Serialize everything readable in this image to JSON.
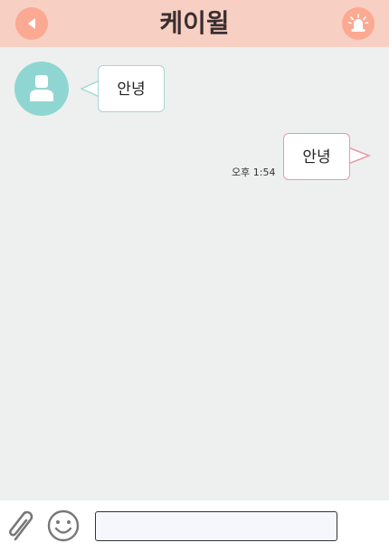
{
  "header": {
    "title": "케이윌",
    "back_icon": "back-arrow-icon",
    "alarm_icon": "siren-icon",
    "background_color": "#f8cfc3",
    "button_color": "#fba992"
  },
  "messages": [
    {
      "direction": "incoming",
      "text": "안녕",
      "avatar_icon": "person-icon",
      "border_color": "#a6d8cf"
    },
    {
      "direction": "outgoing",
      "text": "안녕",
      "time": "오후 1:54",
      "border_color": "#e89aa6"
    }
  ],
  "composer": {
    "attach_icon": "paperclip-icon",
    "emoji_icon": "smiley-icon",
    "input_value": "",
    "input_placeholder": ""
  }
}
